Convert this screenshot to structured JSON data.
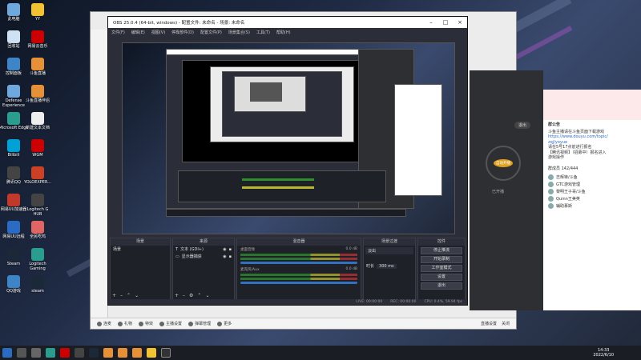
{
  "desktop": {
    "icons": [
      {
        "label": "此电脑",
        "color": "#6fa8dc"
      },
      {
        "label": "YY",
        "color": "#f1c232"
      },
      {
        "label": "回收站",
        "color": "#cfe2f3"
      },
      {
        "label": "网易云音乐",
        "color": "#cc0000"
      },
      {
        "label": "控制面板",
        "color": "#3d85c6"
      },
      {
        "label": "斗鱼直播",
        "color": "#e69138"
      },
      {
        "label": "Defense Experience",
        "color": "#6fa8dc"
      },
      {
        "label": "斗鱼直播伴侣",
        "color": "#e69138"
      },
      {
        "label": "Microsoft Edge",
        "color": "#2a9d8f"
      },
      {
        "label": "新建文本文档",
        "color": "#eeeeee"
      },
      {
        "label": "Bilibili",
        "color": "#00a1d6"
      },
      {
        "label": "WGM",
        "color": "#cc0000"
      },
      {
        "label": "腾讯QQ",
        "color": "#444444"
      },
      {
        "label": "YOLOEXPER...",
        "color": "#cc4125"
      },
      {
        "label": "网易UU加速器",
        "color": "#c0392b"
      },
      {
        "label": "Logitech G HUB",
        "color": "#444444"
      },
      {
        "label": "网易UU远程",
        "color": "#2a6cc4"
      },
      {
        "label": "全民吃鸡",
        "color": "#e06666"
      },
      {
        "label": "Steam",
        "color": "#1b2838"
      },
      {
        "label": "Logitech Gaming",
        "color": "#2a9d8f"
      },
      {
        "label": "QQ游戏",
        "color": "#3d85c6"
      },
      {
        "label": "steam",
        "color": "#1b2838"
      }
    ]
  },
  "obs": {
    "title": "OBS 25.0.4 (64-bit, windows) - 配置文件: 未命名 - 场景: 未命名",
    "menu": [
      "文件(F)",
      "编辑(E)",
      "视图(V)",
      "停靠部件(D)",
      "配置文件(P)",
      "场景集合(S)",
      "工具(T)",
      "帮助(H)"
    ],
    "docks": {
      "scenes": {
        "header": "场景",
        "items": [
          "场景"
        ]
      },
      "sources": {
        "header": "来源",
        "items": [
          "文本 (GDI+)",
          "显示器捕获"
        ]
      },
      "mixer": {
        "header": "混音器",
        "channels": [
          {
            "name": "桌面音频",
            "level": "0.0 dB"
          },
          {
            "name": "麦克风/Aux",
            "level": "0.0 dB"
          }
        ]
      },
      "transitions": {
        "header": "场景过渡",
        "type": "淡出",
        "duration_label": "时长",
        "duration": "300 ms"
      },
      "controls": {
        "header": "控件",
        "buttons": [
          "停止推流",
          "开始录制",
          "工作室模式",
          "设置",
          "退出"
        ]
      }
    },
    "status": {
      "live": "LIVE: 00:00:00",
      "rec": "REC: 00:00:00",
      "cpu": "CPU: 0.4%, 59.94 fps"
    }
  },
  "host_window": {
    "bottom_bar": [
      "连麦",
      "礼物",
      "特效",
      "主播设置",
      "弹幕管理",
      "更多"
    ],
    "right_items": [
      "直播设置",
      "关闭"
    ]
  },
  "chat": {
    "notice_title": "群公告",
    "notice_lines": [
      "群公告",
      "斗鱼主播请在斗鱼页面下载游戏",
      "https://www.douyu.com/topic/",
      "zqj/yoyue",
      "请在5号17点前进行报名",
      "【腾讯视频】（招募中）报名进入",
      "游戏操作"
    ],
    "member_count": "群成员 142/444",
    "members": [
      "志辉锋/斗鱼",
      "GTC游戏管理",
      "黎明王子哥/斗鱼",
      "Quinn王美英",
      "辅助慕斯"
    ]
  },
  "dark_panel": {
    "button": "退出",
    "center": "自动开播",
    "status": "已开播"
  },
  "taskbar": {
    "time": "14:33",
    "date": "2022/6/10"
  }
}
